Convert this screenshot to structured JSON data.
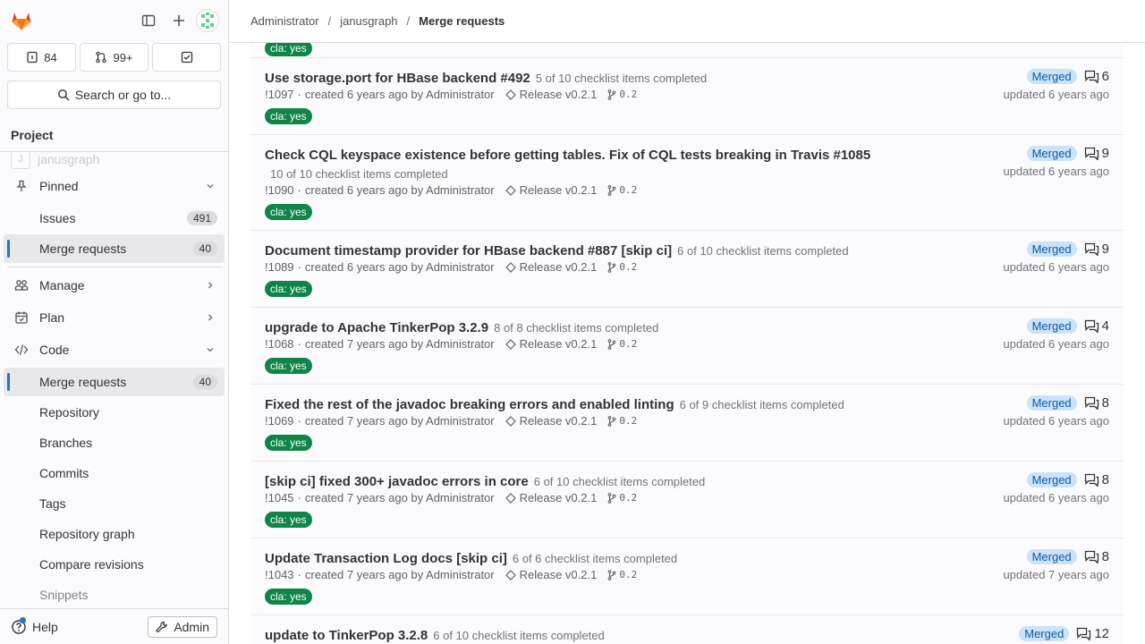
{
  "sidebar": {
    "counts": {
      "issues": "84",
      "merge_requests": "99+"
    },
    "search_label": "Search or go to...",
    "section_label": "Project",
    "faded_item": {
      "initial": "J",
      "label": "janusgraph"
    },
    "pinned": {
      "label": "Pinned",
      "issues_label": "Issues",
      "issues_count": "491",
      "mr_label": "Merge requests",
      "mr_count": "40"
    },
    "manage_label": "Manage",
    "plan_label": "Plan",
    "code": {
      "label": "Code",
      "mr_label": "Merge requests",
      "mr_count": "40",
      "repository": "Repository",
      "branches": "Branches",
      "commits": "Commits",
      "tags": "Tags",
      "repo_graph": "Repository graph",
      "compare": "Compare revisions",
      "snippets": "Snippets"
    },
    "help_label": "Help",
    "admin_label": "Admin"
  },
  "breadcrumb": [
    "Administrator",
    "janusgraph",
    "Merge requests"
  ],
  "merge_requests": [
    {
      "title": "Use storage.port for HBase backend #492",
      "checklist": "5 of 10 checklist items completed",
      "ref": "!1097",
      "created": "created 6 years ago by Administrator",
      "milestone": "Release v0.2.1",
      "branch": "0.2",
      "label": "cla: yes",
      "status": "Merged",
      "comments": "6",
      "updated": "updated 6 years ago"
    },
    {
      "title": "Check CQL keyspace existence before getting tables. Fix of CQL tests breaking in Travis #1085",
      "checklist": "10 of 10 checklist items completed",
      "ref": "!1090",
      "created": "created 6 years ago by Administrator",
      "milestone": "Release v0.2.1",
      "branch": "0.2",
      "label": "cla: yes",
      "status": "Merged",
      "comments": "9",
      "updated": "updated 6 years ago"
    },
    {
      "title": "Document timestamp provider for HBase backend #887 [skip ci]",
      "checklist": "6 of 10 checklist items completed",
      "ref": "!1089",
      "created": "created 6 years ago by Administrator",
      "milestone": "Release v0.2.1",
      "branch": "0.2",
      "label": "cla: yes",
      "status": "Merged",
      "comments": "9",
      "updated": "updated 6 years ago"
    },
    {
      "title": "upgrade to Apache TinkerPop 3.2.9",
      "checklist": "8 of 8 checklist items completed",
      "ref": "!1068",
      "created": "created 7 years ago by Administrator",
      "milestone": "Release v0.2.1",
      "branch": "0.2",
      "label": "cla: yes",
      "status": "Merged",
      "comments": "4",
      "updated": "updated 6 years ago"
    },
    {
      "title": "Fixed the rest of the javadoc breaking errors and enabled linting",
      "checklist": "6 of 9 checklist items completed",
      "ref": "!1069",
      "created": "created 7 years ago by Administrator",
      "milestone": "Release v0.2.1",
      "branch": "0.2",
      "label": "cla: yes",
      "status": "Merged",
      "comments": "8",
      "updated": "updated 6 years ago"
    },
    {
      "title": "[skip ci] fixed 300+ javadoc errors in core",
      "checklist": "6 of 10 checklist items completed",
      "ref": "!1045",
      "created": "created 7 years ago by Administrator",
      "milestone": "Release v0.2.1",
      "branch": "0.2",
      "label": "cla: yes",
      "status": "Merged",
      "comments": "8",
      "updated": "updated 6 years ago"
    },
    {
      "title": "Update Transaction Log docs [skip ci]",
      "checklist": "6 of 6 checklist items completed",
      "ref": "!1043",
      "created": "created 7 years ago by Administrator",
      "milestone": "Release v0.2.1",
      "branch": "0.2",
      "label": "cla: yes",
      "status": "Merged",
      "comments": "8",
      "updated": "updated 7 years ago"
    },
    {
      "title": "update to TinkerPop 3.2.8",
      "checklist": "6 of 10 checklist items completed",
      "status": "Merged",
      "comments": "12"
    }
  ],
  "partial_label_top": "cla: yes",
  "colors": {
    "accent": "#1f75cb",
    "label_green": "#108548",
    "merged_badge_bg": "#cbe2f9",
    "merged_badge_text": "#0b5cad"
  }
}
